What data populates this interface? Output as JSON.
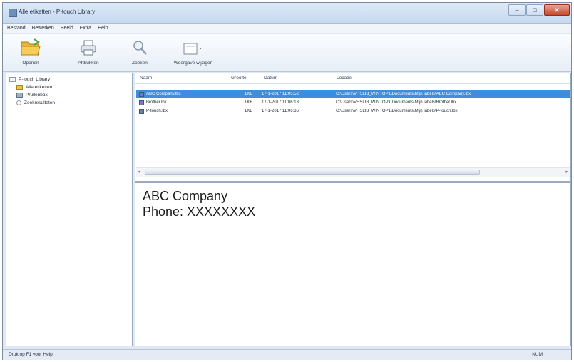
{
  "window": {
    "title": "Alle etiketten - P-touch Library"
  },
  "menu": {
    "items": [
      "Bestand",
      "Bewerken",
      "Beeld",
      "Extra",
      "Help"
    ]
  },
  "toolbar": {
    "open_label": "Openen",
    "print_label": "Afdrukken",
    "search_label": "Zoeken",
    "view_label": "Weergave wijzigen"
  },
  "tree": {
    "root": "P-touch Library",
    "items": [
      "Alle etiketten",
      "Prullenbak",
      "Zoekresultaten"
    ]
  },
  "list": {
    "columns": {
      "name": "Naam",
      "size": "Grootte",
      "date": "Datum",
      "location": "Locatie"
    },
    "rows": [
      {
        "name": "ABC Company.lbx",
        "size": "1KB",
        "date": "17-1-2017 11:05:52",
        "location": "C:\\Users\\VHSLIB_WINTOP1\\Documents\\Mijn labels\\ABC Company.lbx"
      },
      {
        "name": "Brother.lbx",
        "size": "1KB",
        "date": "17-1-2017 11:06:13",
        "location": "C:\\Users\\VHSLIB_WINTOP1\\Documents\\Mijn labels\\Brother.lbx"
      },
      {
        "name": "P-touch.lbx",
        "size": "1KB",
        "date": "17-1-2017 11:06:35",
        "location": "C:\\Users\\VHSLIB_WINTOP1\\Documents\\Mijn labels\\P-touch.lbx"
      }
    ]
  },
  "preview": {
    "line1": "ABC Company",
    "line2": "Phone: XXXXXXXX"
  },
  "status": {
    "left": "Druk op F1 voor Help",
    "right": "NUM"
  },
  "colors": {
    "selection": "#3b8ee0",
    "titlebar": "#c7d9ef",
    "close_button": "#c7452b"
  }
}
